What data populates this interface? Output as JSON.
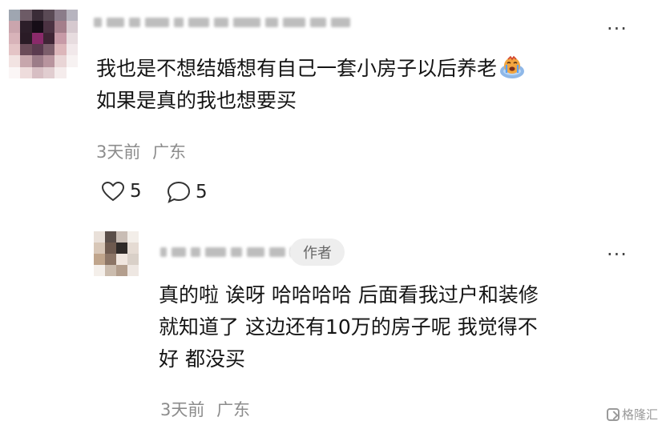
{
  "comment": {
    "lines": [
      "我也是不想结婚想有自己一套小房子以后养老",
      "如果是真的我也想要买"
    ],
    "emoji_icon": "crying-face-emoji",
    "time": "3天前",
    "location": "广东",
    "likes": "5",
    "replies": "5"
  },
  "reply": {
    "badge": "作者",
    "lines": [
      "真的啦 诶呀 哈哈哈哈 后面看我过户和装修",
      "就知道了 这边还有10万的房子呢 我觉得不",
      "好 都没买"
    ],
    "time": "3天前",
    "location": "广东"
  },
  "more_label": "···",
  "watermark": "格隆汇",
  "colors": {
    "text": "#151515",
    "meta": "#8c8c8c",
    "badge_bg": "#eeeeee",
    "avatar_main": [
      "#9fa6b1",
      "#6d5b66",
      "#3a2c37",
      "#5a4a55",
      "#8b7c8a",
      "#b7b4bf",
      "#caa5ad",
      "#2c1e29",
      "#160d17",
      "#4b3242",
      "#a47e8b",
      "#d6c9cf",
      "#d8b3b9",
      "#2a1b26",
      "#8a2a6a",
      "#3f2535",
      "#c79aa7",
      "#e7dcdf",
      "#e4c4c6",
      "#6b4c59",
      "#5b3b4f",
      "#7c5e6b",
      "#dcb6ba",
      "#f1e8ea",
      "#f2e3e2",
      "#c7a6ac",
      "#9c7c88",
      "#b8949e",
      "#e9d5d6",
      "#f7f2f2",
      "#fbf6f6",
      "#eedcdc",
      "#d7bec3",
      "#e1cdd0",
      "#f5ecec",
      "#ffffff"
    ],
    "avatar_reply": [
      "#e9e0d9",
      "#5a4e49",
      "#c9bdb5",
      "#f3eee9",
      "#d8c7b8",
      "#6e5a4f",
      "#2f2a28",
      "#e5dbd3",
      "#c0a58c",
      "#8c7566",
      "#f0e6df",
      "#d9d0c8",
      "#f4efea",
      "#cbbcae",
      "#b39e8d",
      "#eee7e2"
    ]
  }
}
